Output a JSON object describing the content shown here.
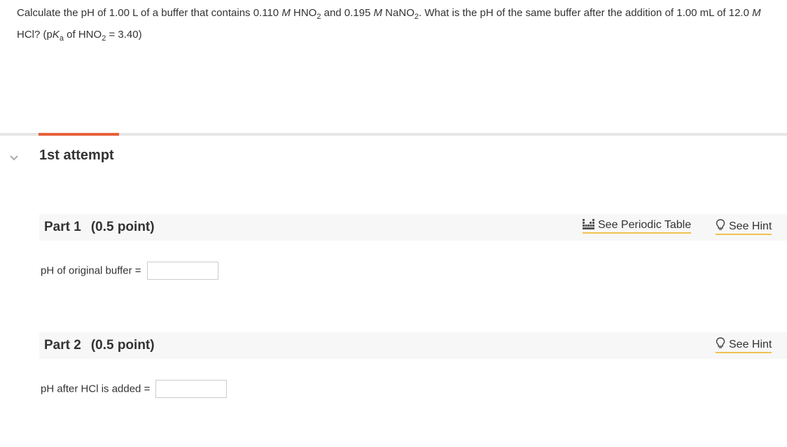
{
  "question": {
    "t1": "Calculate the pH of 1.00 L of a buffer that contains 0.110 ",
    "m1": "M",
    "t2": " HNO",
    "s1": "2",
    "t3": " and 0.195 ",
    "m2": "M",
    "t4": " NaNO",
    "s2": "2",
    "t5": ". What is the pH of the same buffer after the addition of 1.00 mL of 12.0 ",
    "m3": "M",
    "t6": " HCl? (p",
    "k": "K",
    "ka": "a",
    "t7": " of HNO",
    "s3": "2",
    "t8": " = 3.40)"
  },
  "attempt": {
    "label": "1st attempt",
    "collapse_icon": "chevron-down-icon"
  },
  "parts": [
    {
      "label": "Part 1",
      "points": "(0.5 point)",
      "periodic_table": "See Periodic Table",
      "hint": "See Hint",
      "answer_label": "pH of original buffer =",
      "answer_value": ""
    },
    {
      "label": "Part 2",
      "points": "(0.5 point)",
      "hint": "See Hint",
      "answer_label": "pH after HCl is added =",
      "answer_value": ""
    }
  ],
  "colors": {
    "accent": "#e8613a",
    "link_underline": "#f0c24e",
    "bar": "#f7f7f7"
  }
}
